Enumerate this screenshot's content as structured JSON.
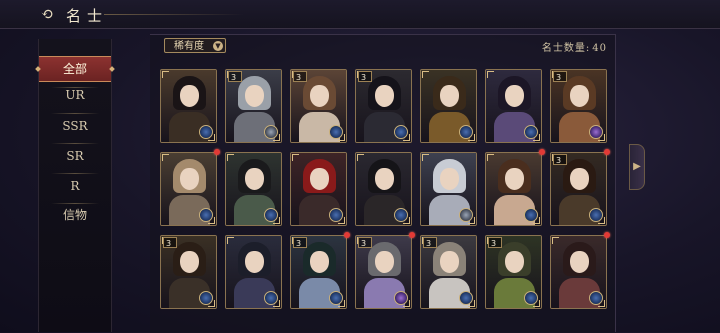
{
  "header": {
    "title": "名士",
    "back_icon": "swirl-back-icon"
  },
  "sidebar": {
    "items": [
      {
        "label": "全部",
        "active": true
      },
      {
        "label": "UR"
      },
      {
        "label": "SSR"
      },
      {
        "label": "SR"
      },
      {
        "label": "R"
      },
      {
        "label": "信物"
      }
    ]
  },
  "filter": {
    "label": "稀有度",
    "icon": "chevron-down-icon"
  },
  "count": {
    "label": "名士数量:",
    "value": "40"
  },
  "cards": [
    {
      "level": "",
      "rank": "blue",
      "hair": "#1a1416",
      "robe": "#3a2e24",
      "bg": "#4a3a2c",
      "dot": false
    },
    {
      "level": "3",
      "rank": "gray",
      "hair": "#9aa0a8",
      "robe": "#6d6f78",
      "bg": "#3b3d48",
      "dot": false
    },
    {
      "level": "3",
      "rank": "blue",
      "hair": "#6a4a34",
      "robe": "#c9b8a6",
      "bg": "#5b4436",
      "dot": false
    },
    {
      "level": "3",
      "rank": "blue",
      "hair": "#15131a",
      "robe": "#2b2a33",
      "bg": "#2c2a30",
      "dot": false
    },
    {
      "level": "",
      "rank": "blue",
      "hair": "#3a2a1a",
      "robe": "#7a5a2a",
      "bg": "#3a3224",
      "dot": false
    },
    {
      "level": "",
      "rank": "blue",
      "hair": "#1c1626",
      "robe": "#5a4a78",
      "bg": "#2e2a3e",
      "dot": false
    },
    {
      "level": "3",
      "rank": "purple",
      "hair": "#5a3a24",
      "robe": "#8a5a3a",
      "bg": "#4a3424",
      "dot": false
    },
    {
      "level": "",
      "rank": "blue",
      "hair": "#a48a6c",
      "robe": "#7a6a5a",
      "bg": "#4a3e32",
      "dot": true
    },
    {
      "level": "",
      "rank": "blue",
      "hair": "#1a1a1c",
      "robe": "#4a5a4a",
      "bg": "#2e3430",
      "dot": false
    },
    {
      "level": "",
      "rank": "blue",
      "hair": "#8a1a1a",
      "robe": "#3a2a2a",
      "bg": "#3e2426",
      "dot": false
    },
    {
      "level": "",
      "rank": "blue",
      "hair": "#151418",
      "robe": "#2a2628",
      "bg": "#2a2830",
      "dot": false
    },
    {
      "level": "",
      "rank": "gray",
      "hair": "#c8ccd4",
      "robe": "#a8acb8",
      "bg": "#3e4150",
      "dot": false
    },
    {
      "level": "",
      "rank": "blue",
      "hair": "#4a2e1e",
      "robe": "#c8a890",
      "bg": "#4a3a30",
      "dot": true
    },
    {
      "level": "3",
      "rank": "blue",
      "hair": "#2a1a12",
      "robe": "#4a3a2a",
      "bg": "#342a22",
      "dot": true
    },
    {
      "level": "3",
      "rank": "blue",
      "hair": "#2a1e16",
      "robe": "#3a3028",
      "bg": "#3a3024",
      "dot": false
    },
    {
      "level": "",
      "rank": "blue",
      "hair": "#1c1e2a",
      "robe": "#3a3a58",
      "bg": "#2a2c3c",
      "dot": false
    },
    {
      "level": "3",
      "rank": "blue",
      "hair": "#1a2a2a",
      "robe": "#7a8aa8",
      "bg": "#2c3440",
      "dot": true
    },
    {
      "level": "3",
      "rank": "purple",
      "hair": "#6a6a6e",
      "robe": "#8a7ab0",
      "bg": "#3e3a4a",
      "dot": true
    },
    {
      "level": "3",
      "rank": "blue",
      "hair": "#8a8278",
      "robe": "#c8c4c0",
      "bg": "#3c3a40",
      "dot": false
    },
    {
      "level": "3",
      "rank": "blue",
      "hair": "#3a3e2a",
      "robe": "#6a7a3a",
      "bg": "#2e3424",
      "dot": false
    },
    {
      "level": "",
      "rank": "blue",
      "hair": "#2a1a1a",
      "robe": "#6a3a3a",
      "bg": "#3a2a2a",
      "dot": true
    }
  ],
  "nav": {
    "next_icon": "chevron-right-icon"
  }
}
